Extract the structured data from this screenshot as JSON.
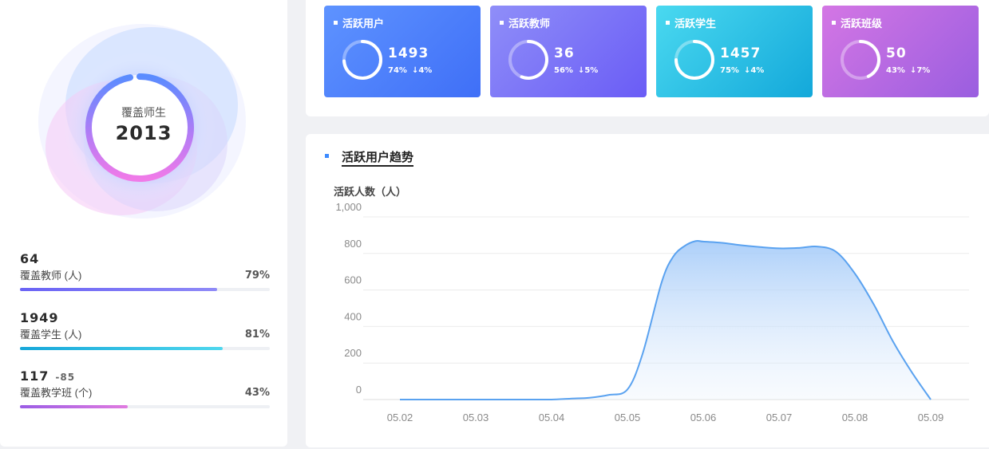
{
  "coverage": {
    "label": "覆盖师生",
    "value": "2013"
  },
  "stats": [
    {
      "value": "64",
      "diff": "",
      "label": "覆盖教师 (人)",
      "percent": "79%",
      "fraction": 0.79,
      "colors": [
        "#6a63f5",
        "#8f8af7"
      ]
    },
    {
      "value": "1949",
      "diff": "",
      "label": "覆盖学生 (人)",
      "percent": "81%",
      "fraction": 0.81,
      "colors": [
        "#17a7d9",
        "#4fd7ee"
      ]
    },
    {
      "value": "117",
      "diff": "-85",
      "label": "覆盖教学班 (个)",
      "percent": "43%",
      "fraction": 0.43,
      "colors": [
        "#9b5de5",
        "#e07be0"
      ]
    }
  ],
  "cards": [
    {
      "title": "活跃用户",
      "value": "1493",
      "percent": "74%",
      "change": "↓4%",
      "fraction": 0.74,
      "colors": [
        "#5e93ff",
        "#3f6ff7"
      ]
    },
    {
      "title": "活跃教师",
      "value": "36",
      "percent": "56%",
      "change": "↓5%",
      "fraction": 0.56,
      "colors": [
        "#8f8ef8",
        "#6a5cf6"
      ]
    },
    {
      "title": "活跃学生",
      "value": "1457",
      "percent": "75%",
      "change": "↓4%",
      "fraction": 0.75,
      "colors": [
        "#4ad9f0",
        "#13a8da"
      ]
    },
    {
      "title": "活跃班级",
      "value": "50",
      "percent": "43%",
      "change": "↓7%",
      "fraction": 0.43,
      "colors": [
        "#d476e4",
        "#9a5ee0"
      ]
    }
  ],
  "chart_data": {
    "type": "area",
    "title": "活跃用户趋势",
    "ylabel": "活跃人数（人）",
    "xlabel": "",
    "categories": [
      "05.02",
      "05.03",
      "05.04",
      "05.05",
      "05.06",
      "05.07",
      "05.08",
      "05.09"
    ],
    "x": [
      0,
      0.25,
      0.5,
      0.75,
      1,
      1.25,
      1.5,
      1.75,
      2,
      2.25,
      2.5,
      2.75,
      3,
      3.2,
      3.45,
      3.6,
      3.75,
      3.9,
      4,
      4.25,
      4.5,
      4.75,
      5,
      5.25,
      5.5,
      5.75,
      6,
      6.25,
      6.5,
      6.75,
      7
    ],
    "values": [
      0,
      0,
      0,
      0,
      0,
      0,
      0,
      0,
      0,
      5,
      10,
      25,
      55,
      250,
      640,
      780,
      840,
      868,
      865,
      858,
      845,
      835,
      828,
      830,
      838,
      810,
      690,
      520,
      320,
      150,
      0
    ],
    "ylim": [
      0,
      1000
    ],
    "yticks": [
      "0",
      "200",
      "400",
      "600",
      "800",
      "1,000"
    ],
    "ytick_values": [
      0,
      200,
      400,
      600,
      800,
      1000
    ],
    "grid": true,
    "color": "#5aa2f0"
  }
}
